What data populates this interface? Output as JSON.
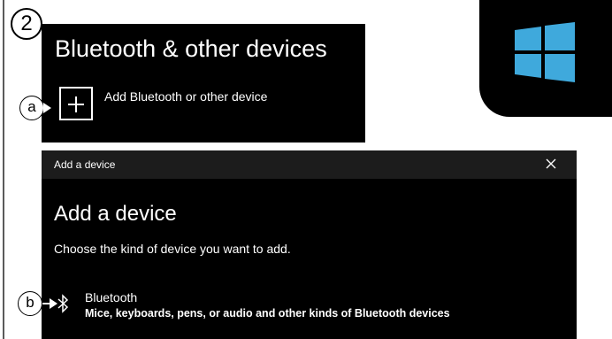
{
  "step": {
    "number": "2"
  },
  "settings_panel": {
    "title": "Bluetooth & other devices",
    "add_device_label": "Add Bluetooth or other device"
  },
  "callouts": {
    "a": "a",
    "b": "b"
  },
  "dialog": {
    "window_title": "Add a device",
    "heading": "Add a device",
    "subtitle": "Choose the kind of device you want to add.",
    "options": [
      {
        "label": "Bluetooth",
        "description": "Mice, keyboards, pens, or audio and other kinds of Bluetooth devices",
        "icon": "bluetooth-icon"
      }
    ]
  },
  "icons": {
    "logo": "windows-logo-icon",
    "add": "plus-icon",
    "close": "close-icon"
  },
  "colors": {
    "panel_bg": "#000000",
    "dialog_titlebar": "#1c1c1c",
    "windows_logo": "#3fa9dc",
    "text": "#ffffff"
  }
}
